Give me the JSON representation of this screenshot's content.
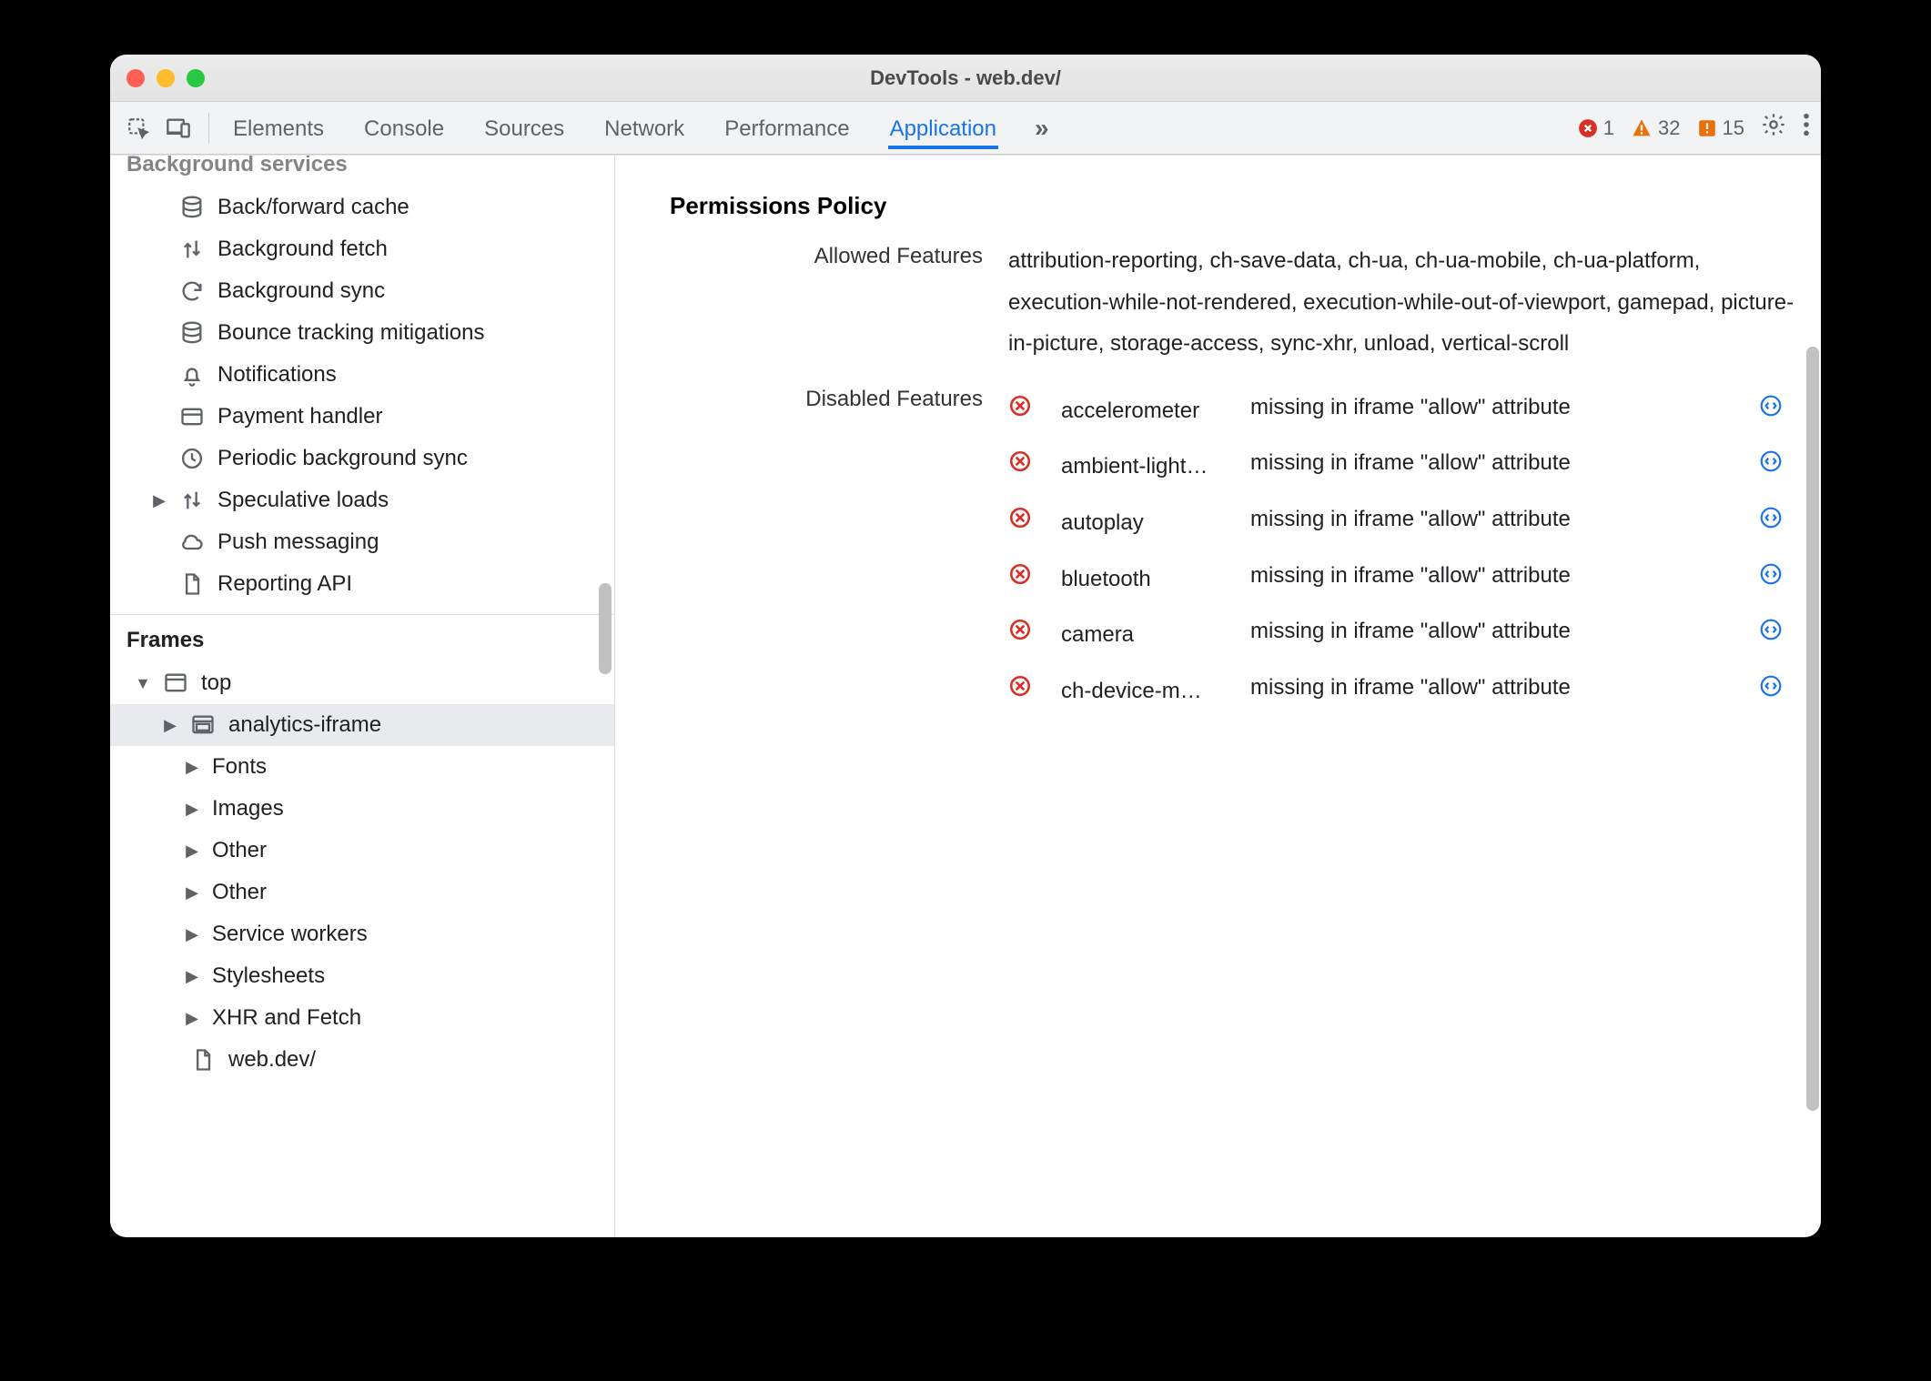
{
  "window": {
    "title": "DevTools - web.dev/"
  },
  "toolbar": {
    "tabs": [
      "Elements",
      "Console",
      "Sources",
      "Network",
      "Performance",
      "Application"
    ],
    "active_tab_index": 5,
    "counts": {
      "errors": "1",
      "warnings": "32",
      "issues": "15"
    }
  },
  "sidebar": {
    "section_title": "Background services",
    "items": [
      {
        "icon": "db",
        "label": "Back/forward cache"
      },
      {
        "icon": "updown",
        "label": "Background fetch"
      },
      {
        "icon": "sync",
        "label": "Background sync"
      },
      {
        "icon": "db",
        "label": "Bounce tracking mitigations"
      },
      {
        "icon": "bell",
        "label": "Notifications"
      },
      {
        "icon": "card",
        "label": "Payment handler"
      },
      {
        "icon": "clock",
        "label": "Periodic background sync"
      },
      {
        "icon": "updown",
        "label": "Speculative loads",
        "expandable": true
      },
      {
        "icon": "cloud",
        "label": "Push messaging"
      },
      {
        "icon": "file",
        "label": "Reporting API"
      }
    ],
    "frames_title": "Frames",
    "frames": {
      "top_label": "top",
      "children": [
        {
          "label": "analytics-iframe",
          "icon": "embed",
          "selected": true,
          "expandable": true
        },
        {
          "label": "Fonts",
          "icon": "",
          "expandable": true
        },
        {
          "label": "Images",
          "icon": "",
          "expandable": true
        },
        {
          "label": "Other",
          "icon": "",
          "expandable": true
        },
        {
          "label": "Other",
          "icon": "",
          "expandable": true
        },
        {
          "label": "Service workers",
          "icon": "",
          "expandable": true
        },
        {
          "label": "Stylesheets",
          "icon": "",
          "expandable": true
        },
        {
          "label": "XHR and Fetch",
          "icon": "",
          "expandable": true
        },
        {
          "label": "web.dev/",
          "icon": "file",
          "expandable": false
        }
      ]
    }
  },
  "main": {
    "heading": "Permissions Policy",
    "allowed_label": "Allowed Features",
    "allowed_value": "attribution-reporting, ch-save-data, ch-ua, ch-ua-mobile, ch-ua-platform, execution-while-not-rendered, execution-while-out-of-viewport, gamepad, picture-in-picture, storage-access, sync-xhr, unload, vertical-scroll",
    "disabled_label": "Disabled Features",
    "disabled": [
      {
        "feature": "accelerometer",
        "reason": "missing in iframe \"allow\" attribute"
      },
      {
        "feature": "ambient-light…",
        "reason": "missing in iframe \"allow\" attribute"
      },
      {
        "feature": "autoplay",
        "reason": "missing in iframe \"allow\" attribute"
      },
      {
        "feature": "bluetooth",
        "reason": "missing in iframe \"allow\" attribute"
      },
      {
        "feature": "camera",
        "reason": "missing in iframe \"allow\" attribute"
      },
      {
        "feature": "ch-device-m…",
        "reason": "missing in iframe \"allow\" attribute"
      }
    ]
  }
}
